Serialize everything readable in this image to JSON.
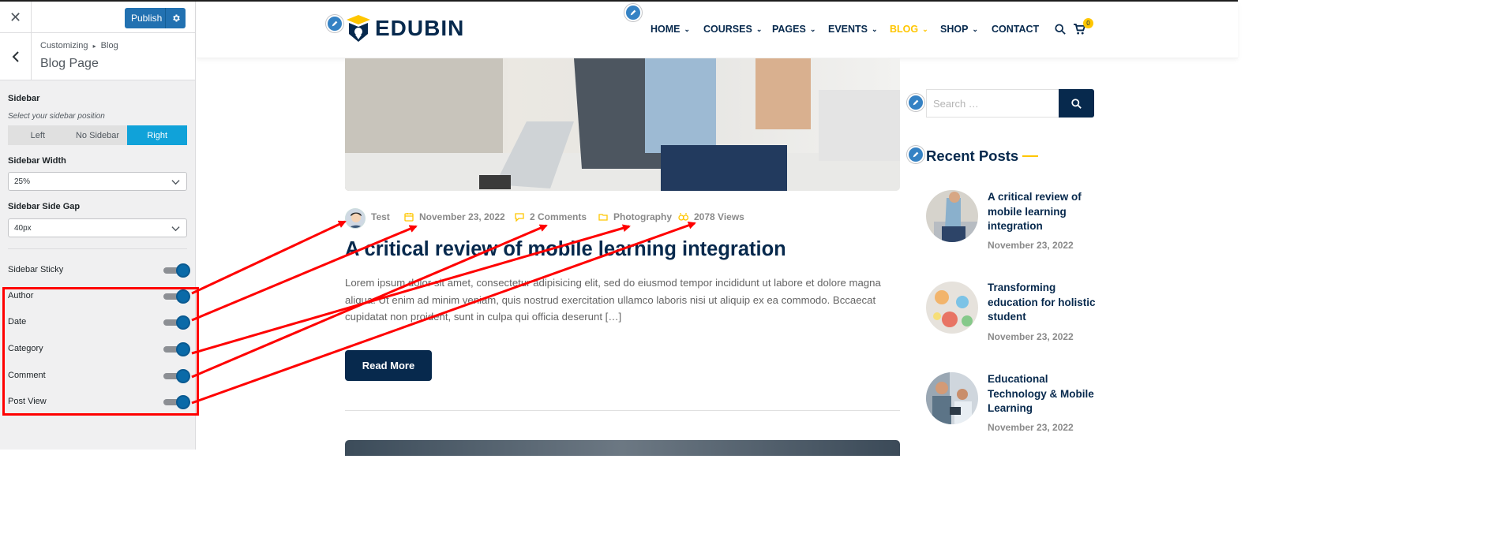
{
  "customizer": {
    "close_label": "✕",
    "publish_label": "Publish",
    "breadcrumb_root": "Customizing",
    "breadcrumb_sep": "▸",
    "breadcrumb_leaf": "Blog",
    "section_title": "Blog Page",
    "sidebar_label": "Sidebar",
    "sidebar_desc": "Select your sidebar position",
    "sidebar_options": [
      "Left",
      "No Sidebar",
      "Right"
    ],
    "sidebar_selected": "Right",
    "sidebar_width_label": "Sidebar Width",
    "sidebar_width_value": "25%",
    "sidebar_gap_label": "Sidebar Side Gap",
    "sidebar_gap_value": "40px",
    "toggles": [
      {
        "label": "Sidebar Sticky",
        "on": true
      },
      {
        "label": "Author",
        "on": true
      },
      {
        "label": "Date",
        "on": true
      },
      {
        "label": "Category",
        "on": true
      },
      {
        "label": "Comment",
        "on": true
      },
      {
        "label": "Post View",
        "on": true
      }
    ]
  },
  "site": {
    "logo_text": "EDUBIN",
    "nav": [
      {
        "label": "HOME",
        "caret": true
      },
      {
        "label": "COURSES",
        "caret": true
      },
      {
        "label": "PAGES",
        "caret": true
      },
      {
        "label": "EVENTS",
        "caret": true
      },
      {
        "label": "BLOG",
        "caret": true,
        "active": true
      },
      {
        "label": "SHOP",
        "caret": true
      },
      {
        "label": "CONTACT",
        "caret": false
      }
    ],
    "cart_count": "0",
    "accent_color": "#ffc600",
    "brand_color": "#07294d"
  },
  "post": {
    "author": "Test",
    "date": "November 23, 2022",
    "comments": "2 Comments",
    "category": "Photography",
    "views": "2078 Views",
    "title": "A critical review of mobile learning integration",
    "excerpt": "Lorem ipsum dolor sit amet, consectetur adipisicing elit, sed do eiusmod tempor incididunt ut labore et dolore magna aliqua. Ut enim ad minim veniam, quis nostrud exercitation ullamco laboris nisi ut aliquip ex ea commodo. Bccaecat cupidatat non proident, sunt in culpa qui officia deserunt […]",
    "read_more": "Read More"
  },
  "sidebar_widget": {
    "search_placeholder": "Search …",
    "recent_title": "Recent Posts",
    "recent_posts": [
      {
        "title": "A critical review of mobile learning integration",
        "date": "November 23, 2022"
      },
      {
        "title": "Transforming education for holistic student",
        "date": "November 23, 2022"
      },
      {
        "title": "Educational Technology & Mobile Learning",
        "date": "November 23, 2022"
      }
    ]
  },
  "annotation": {
    "highlight_color": "#ff0000"
  }
}
